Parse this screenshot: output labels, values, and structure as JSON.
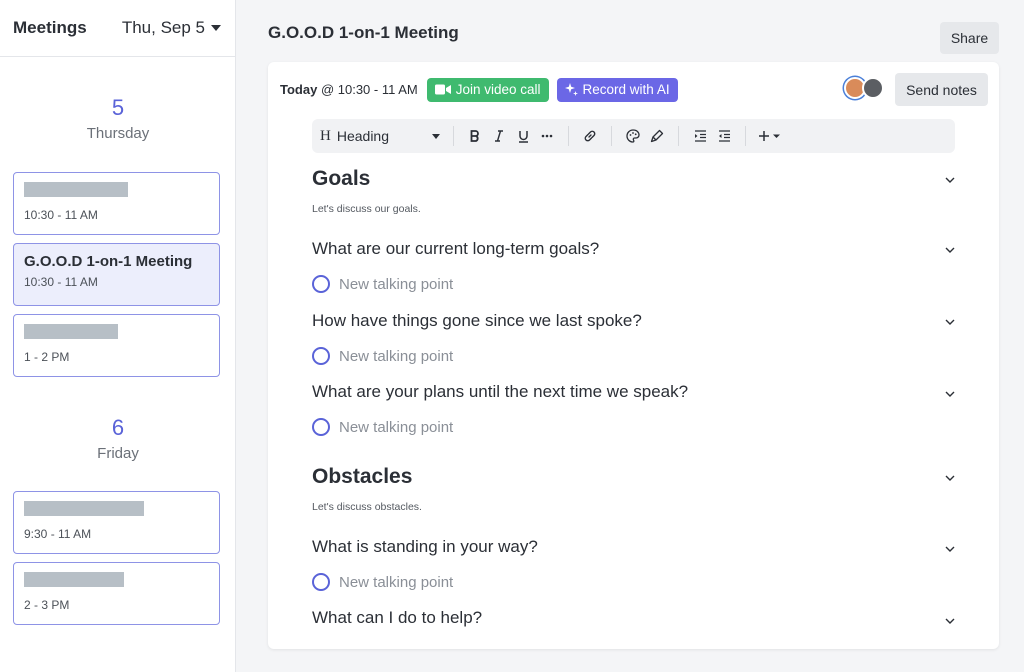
{
  "sidebar": {
    "title": "Meetings",
    "date_label": "Thu, Sep 5",
    "days": [
      {
        "number": "5",
        "name": "Thursday",
        "events": [
          {
            "title": "",
            "redacted": true,
            "time": "10:30 - 11 AM"
          },
          {
            "title": "G.O.O.D 1-on-1 Meeting",
            "redacted": false,
            "time": "10:30 - 11 AM",
            "selected": true
          },
          {
            "title": "",
            "redacted": true,
            "time": "1 - 2 PM"
          }
        ]
      },
      {
        "number": "6",
        "name": "Friday",
        "events": [
          {
            "title": "",
            "redacted": true,
            "time": "9:30 - 11 AM"
          },
          {
            "title": "",
            "redacted": true,
            "time": "2 - 3 PM"
          }
        ]
      }
    ]
  },
  "main": {
    "title": "G.O.O.D 1-on-1 Meeting",
    "share_label": "Share",
    "when_bold": "Today",
    "when_rest": " @ 10:30 - 11 AM",
    "join_label": "Join video call",
    "record_label": "Record with AI",
    "send_label": "Send notes",
    "toolbar": {
      "style_label": "Heading",
      "style_icon": "H"
    },
    "talking_point_placeholder": "New talking point",
    "sections": [
      {
        "heading": "Goals",
        "subtitle": "Let's discuss our goals.",
        "questions": [
          "What are our current long-term goals?",
          "How have things gone since we last spoke?",
          "What are your plans until the next time we speak?"
        ]
      },
      {
        "heading": "Obstacles",
        "subtitle": "Let's discuss obstacles.",
        "questions": [
          "What is standing in your way?",
          "What can I do to help?"
        ]
      }
    ]
  },
  "colors": {
    "accent": "#5a63d8",
    "join_green": "#3fba6f",
    "record_purple": "#6b67e6",
    "redaction_gray": "#b7bfc6"
  }
}
